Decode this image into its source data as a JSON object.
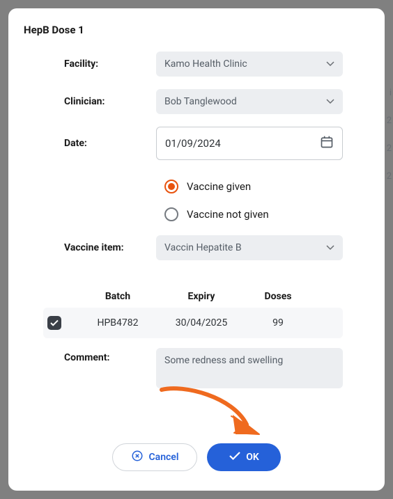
{
  "title": "HepB Dose 1",
  "fields": {
    "facility": {
      "label": "Facility:",
      "value": "Kamo Health Clinic"
    },
    "clinician": {
      "label": "Clinician:",
      "value": "Bob Tanglewood"
    },
    "date": {
      "label": "Date:",
      "value": "01/09/2024"
    },
    "vaccine_item": {
      "label": "Vaccine item:",
      "value": "Vaccin Hepatite B"
    },
    "comment": {
      "label": "Comment:",
      "value": "Some redness and swelling"
    }
  },
  "radio": {
    "given": "Vaccine given",
    "not_given": "Vaccine not given"
  },
  "batch_table": {
    "headers": {
      "batch": "Batch",
      "expiry": "Expiry",
      "doses": "Doses"
    },
    "row": {
      "batch": "HPB4782",
      "expiry": "30/04/2025",
      "doses": "99"
    }
  },
  "buttons": {
    "cancel": "Cancel",
    "ok": "OK"
  },
  "background_hints": {
    "a": "i",
    "b": "2",
    "c": "2"
  }
}
